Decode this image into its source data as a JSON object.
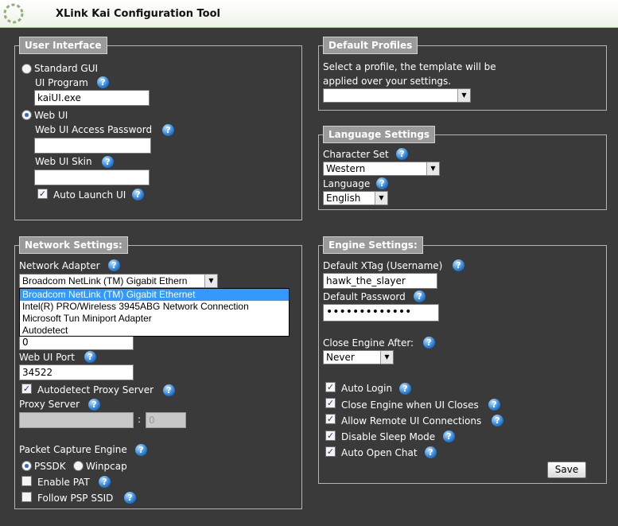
{
  "app": {
    "title": "XLink Kai Configuration Tool"
  },
  "user_interface": {
    "legend": "User Interface",
    "standard_gui_label": "Standard GUI",
    "standard_gui_selected": false,
    "ui_program_label": "UI Program",
    "ui_program_value": "kaiUI.exe",
    "web_ui_label": "Web UI",
    "web_ui_selected": true,
    "web_ui_password_label": "Web UI Access Password",
    "web_ui_password_value": "",
    "web_ui_skin_label": "Web UI Skin",
    "web_ui_skin_value": "",
    "auto_launch_label": "Auto Launch UI",
    "auto_launch_checked": true
  },
  "default_profiles": {
    "legend": "Default Profiles",
    "desc_line1": "Select a profile, the template will be",
    "desc_line2": "applied over your settings.",
    "selected": ""
  },
  "language_settings": {
    "legend": "Language Settings",
    "charset_label": "Character Set",
    "charset_value": "Western",
    "language_label": "Language",
    "language_value": "English"
  },
  "network_settings": {
    "legend": "Network Settings:",
    "adapter_label": "Network Adapter",
    "adapter_value": "Broadcom NetLink (TM) Gigabit Ethern",
    "adapter_options": [
      "Broadcom NetLink (TM) Gigabit Ethernet",
      "Intel(R) PRO/Wireless 3945ABG Network Connection",
      "Microsoft Tun Miniport Adapter",
      "Autodetect"
    ],
    "hidden_field_value": "0",
    "web_ui_port_label": "Web UI Port",
    "web_ui_port_value": "34522",
    "autodetect_proxy_label": "Autodetect Proxy Server",
    "autodetect_proxy_checked": true,
    "proxy_server_label": "Proxy Server",
    "proxy_host_value": "",
    "proxy_separator": ":",
    "proxy_port_value": "0",
    "packet_capture_label": "Packet Capture Engine",
    "pssdk_label": "PSSDK",
    "pssdk_selected": true,
    "winpcap_label": "Winpcap",
    "winpcap_selected": false,
    "enable_pat_label": "Enable PAT",
    "enable_pat_checked": false,
    "follow_psp_label": "Follow PSP SSID",
    "follow_psp_checked": false
  },
  "engine_settings": {
    "legend": "Engine Settings:",
    "xtag_label": "Default XTag (Username)",
    "xtag_value": "hawk_the_slayer",
    "password_label": "Default Password",
    "password_value": "•••••••••••••",
    "close_after_label": "Close Engine After:",
    "close_after_value": "Never",
    "auto_login_label": "Auto Login",
    "close_on_ui_label": "Close Engine when UI Closes",
    "allow_remote_label": "Allow Remote UI Connections",
    "disable_sleep_label": "Disable Sleep Mode",
    "auto_open_chat_label": "Auto Open Chat",
    "save_label": "Save"
  },
  "icons": {
    "help": "question-mark-help-icon",
    "check": "✓",
    "dropdown": "▼"
  }
}
